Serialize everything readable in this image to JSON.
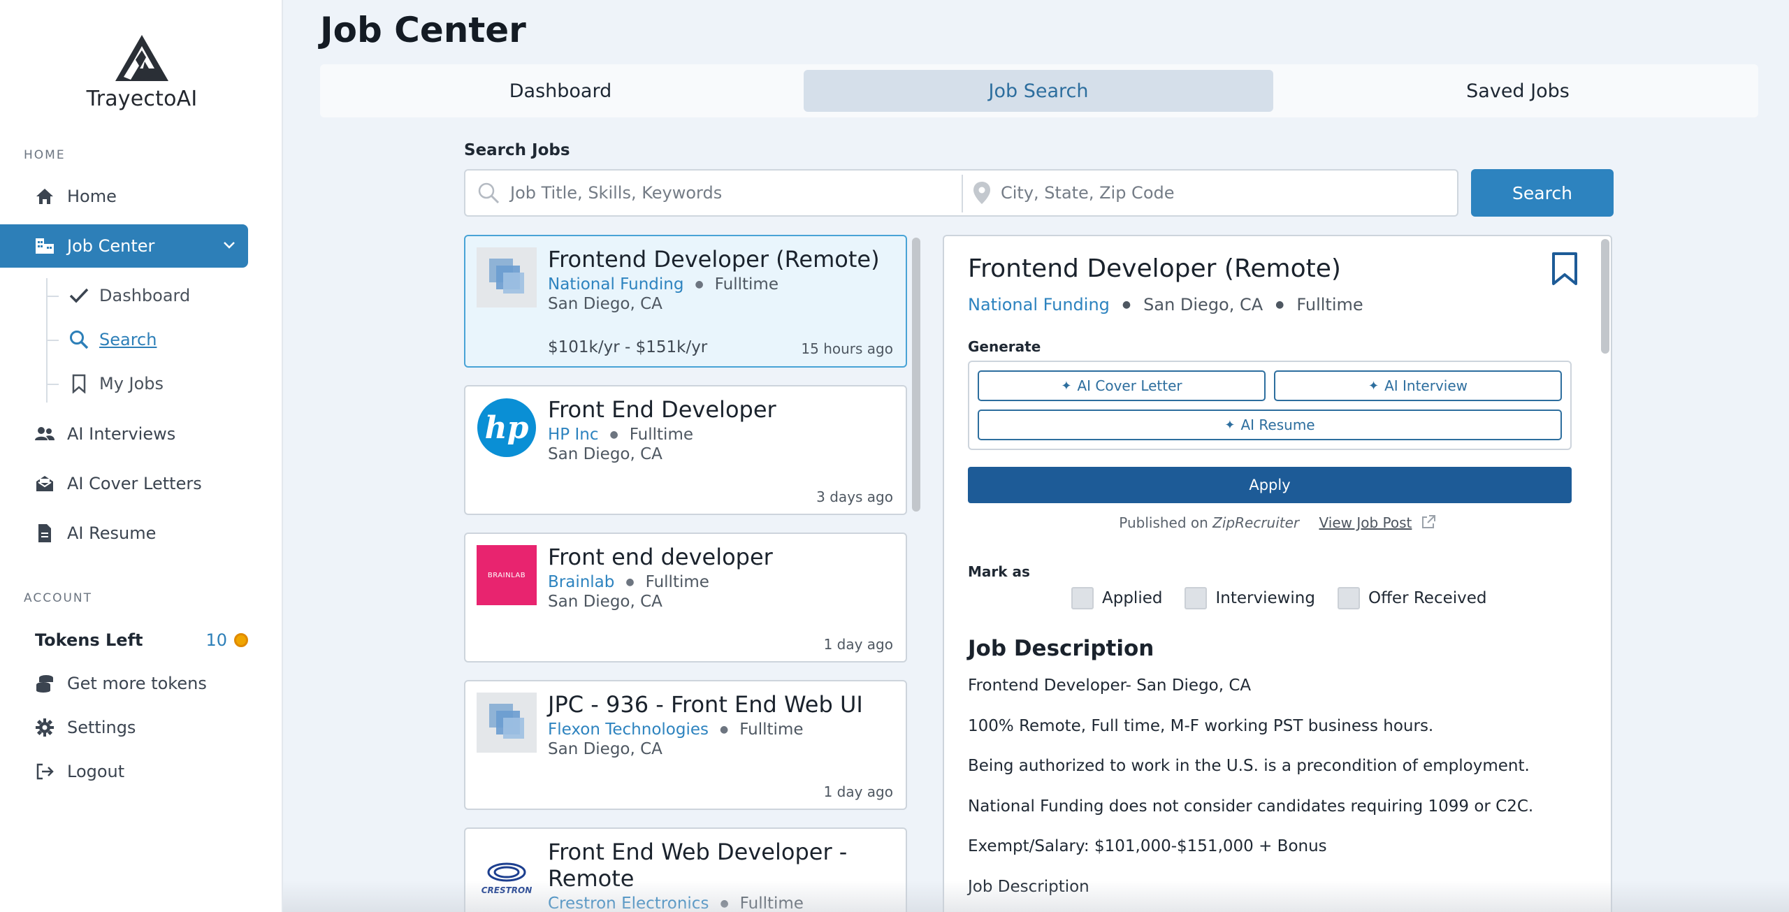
{
  "brand": {
    "name": "TrayectoAI"
  },
  "sidebar": {
    "home_section": "HOME",
    "account_section": "ACCOUNT",
    "items": [
      {
        "label": "Home",
        "icon": "home-icon"
      },
      {
        "label": "Job Center",
        "icon": "job-center-icon"
      },
      {
        "label": "AI Interviews",
        "icon": "users-icon"
      },
      {
        "label": "AI Cover Letters",
        "icon": "envelope-icon"
      },
      {
        "label": "AI Resume",
        "icon": "document-icon"
      }
    ],
    "sub_items": [
      {
        "label": "Dashboard",
        "icon": "check-icon"
      },
      {
        "label": "Search",
        "icon": "search-icon"
      },
      {
        "label": "My Jobs",
        "icon": "bookmark-icon"
      }
    ],
    "tokens": {
      "label": "Tokens Left",
      "count": "10"
    },
    "account_items": [
      {
        "label": "Get more tokens",
        "icon": "coins-icon"
      },
      {
        "label": "Settings",
        "icon": "gear-icon"
      },
      {
        "label": "Logout",
        "icon": "logout-icon"
      }
    ]
  },
  "page": {
    "title": "Job Center"
  },
  "tabs": [
    {
      "label": "Dashboard"
    },
    {
      "label": "Job Search",
      "active": true
    },
    {
      "label": "Saved Jobs"
    }
  ],
  "search": {
    "label": "Search Jobs",
    "keyword_placeholder": "Job Title, Skills, Keywords",
    "location_placeholder": "City, State, Zip Code",
    "button": "Search"
  },
  "jobs": [
    {
      "title": "Frontend Developer (Remote)",
      "company": "National Funding",
      "type": "Fulltime",
      "location": "San Diego, CA",
      "salary": "$101k/yr - $151k/yr",
      "posted": "15 hours ago",
      "logo": "generic-company-logo"
    },
    {
      "title": "Front End Developer",
      "company": "HP Inc",
      "type": "Fulltime",
      "location": "San Diego, CA",
      "posted": "3 days ago",
      "logo": "hp-logo"
    },
    {
      "title": "Front end developer",
      "company": "Brainlab",
      "type": "Fulltime",
      "location": "San Diego, CA",
      "posted": "1 day ago",
      "logo": "brainlab-logo",
      "logo_text": "BRAINLAB"
    },
    {
      "title": "JPC - 936 - Front End Web UI",
      "company": "Flexon Technologies",
      "type": "Fulltime",
      "location": "San Diego, CA",
      "posted": "1 day ago",
      "logo": "generic-company-logo"
    },
    {
      "title": "Front End Web Developer - Remote",
      "title_line1": "Front End Web Developer -",
      "title_line2": "Remote",
      "company": "Crestron Electronics",
      "type": "Fulltime",
      "logo": "crestron-logo",
      "logo_text": "CRESTRON"
    }
  ],
  "detail": {
    "title": "Frontend Developer (Remote)",
    "company": "National Funding",
    "location": "San Diego, CA",
    "type": "Fulltime",
    "generate_label": "Generate",
    "generate_buttons": [
      "AI Cover Letter",
      "AI Interview",
      "AI Resume"
    ],
    "apply": "Apply",
    "published_prefix": "Published on",
    "published_source": "ZipRecruiter",
    "view_post": "View Job Post",
    "mark_label": "Mark as",
    "mark_options": [
      "Applied",
      "Interviewing",
      "Offer Received"
    ],
    "description_title": "Job Description",
    "description_lines": [
      "Frontend Developer- San Diego, CA",
      "100% Remote, Full time, M-F working PST business hours.",
      "Being authorized to work in the U.S. is a precondition of employment.",
      "National Funding does not consider candidates requiring 1099 or C2C.",
      "Exempt/Salary: $101,000-$151,000 + Bonus",
      "Job Description"
    ]
  },
  "colors": {
    "accent": "#2d83bf",
    "apply": "#1d5b97",
    "selected_card": "#e9f5fc",
    "brainlab": "#e8246f",
    "hp": "#0a8fd5"
  }
}
